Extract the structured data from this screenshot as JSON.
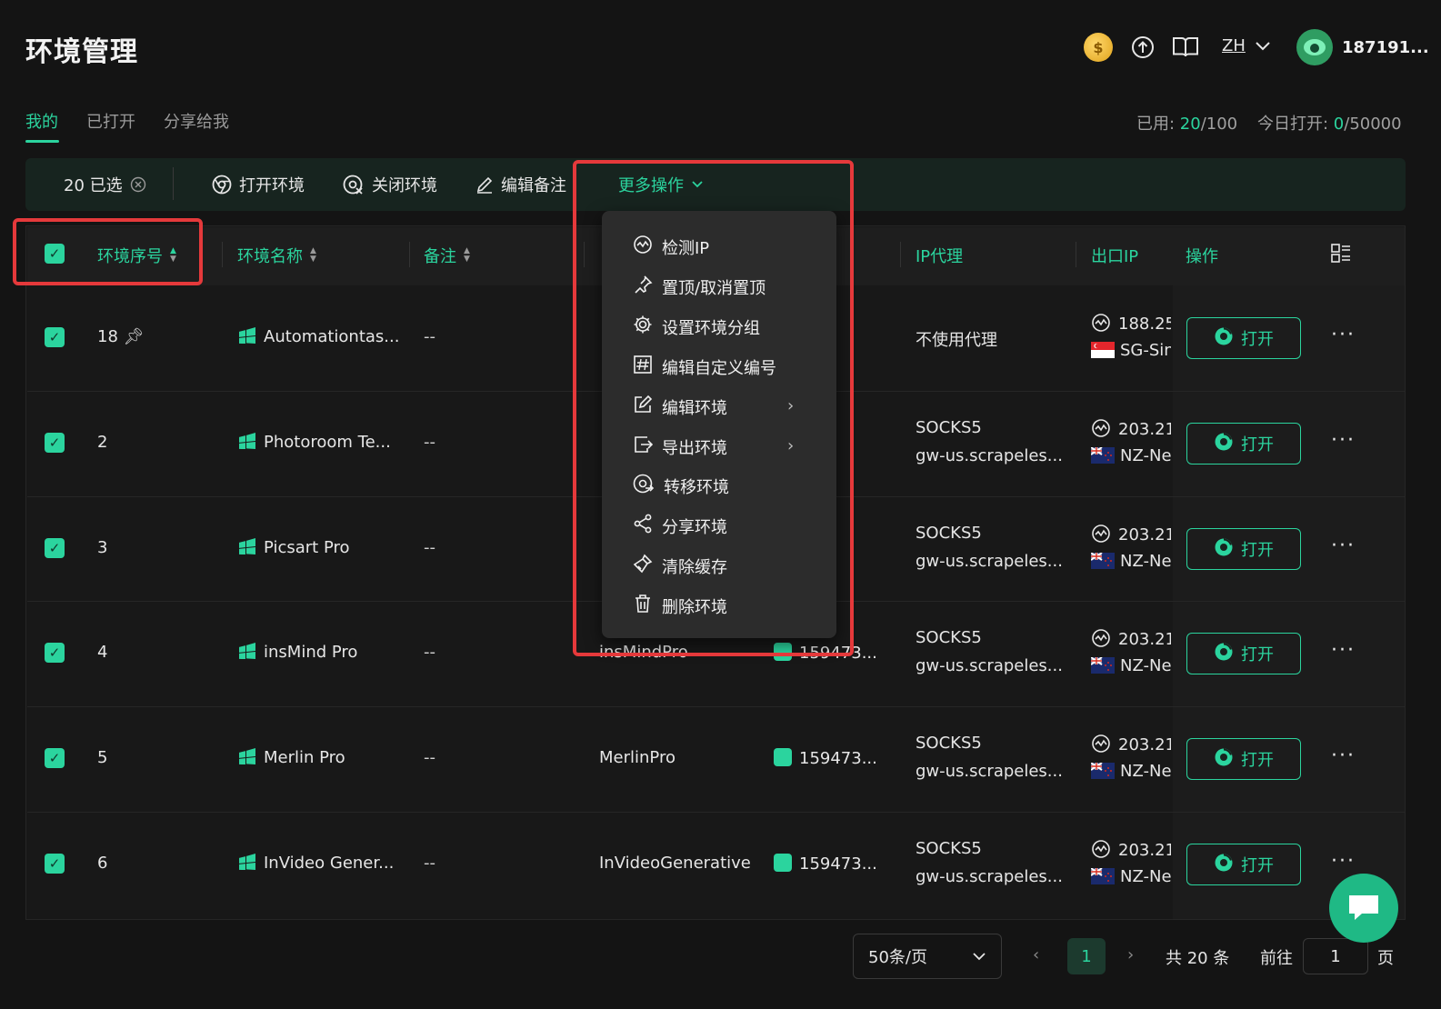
{
  "header": {
    "title": "环境管理",
    "coin_glyph": "$",
    "language": "ZH",
    "username": "187191..."
  },
  "tabs": [
    {
      "label": "我的",
      "active": true
    },
    {
      "label": "已打开",
      "active": false
    },
    {
      "label": "分享给我",
      "active": false
    }
  ],
  "usage": {
    "used_label": "已用: ",
    "used_value": "20",
    "used_total": "/100",
    "today_label": "今日打开: ",
    "today_value": "0",
    "today_total": "/50000"
  },
  "toolbar": {
    "selected_count": "20 已选",
    "open_env": "打开环境",
    "close_env": "关闭环境",
    "edit_note": "编辑备注",
    "more_actions": "更多操作"
  },
  "columns": {
    "seq": "环境序号",
    "name": "环境名称",
    "note": "备注",
    "ip_proxy": "IP代理",
    "exit_ip": "出口IP",
    "actions": "操作"
  },
  "rows": [
    {
      "seq": "18",
      "pinned": true,
      "name": "Automationtas...",
      "note": "--",
      "custom": "",
      "group": "",
      "proxy_line1": "不使用代理",
      "proxy_line2": "",
      "ip_line1": "188.25",
      "ip_line2": "SG-Sin",
      "flag": "sg",
      "open_label": "打开"
    },
    {
      "seq": "2",
      "pinned": false,
      "name": "Photoroom Te...",
      "note": "--",
      "custom": "",
      "group": "",
      "proxy_line1": "SOCKS5",
      "proxy_line2": "gw-us.scrapeles...",
      "ip_line1": "203.21",
      "ip_line2": "NZ-Ne",
      "flag": "nz",
      "open_label": "打开"
    },
    {
      "seq": "3",
      "pinned": false,
      "name": "Picsart Pro",
      "note": "--",
      "custom": "",
      "group": "",
      "proxy_line1": "SOCKS5",
      "proxy_line2": "gw-us.scrapeles...",
      "ip_line1": "203.21",
      "ip_line2": "NZ-Ne",
      "flag": "nz",
      "open_label": "打开"
    },
    {
      "seq": "4",
      "pinned": false,
      "name": "insMind Pro",
      "note": "--",
      "custom": "insMindPro",
      "group": "159473...",
      "proxy_line1": "SOCKS5",
      "proxy_line2": "gw-us.scrapeles...",
      "ip_line1": "203.21",
      "ip_line2": "NZ-Ne",
      "flag": "nz",
      "open_label": "打开"
    },
    {
      "seq": "5",
      "pinned": false,
      "name": "Merlin Pro",
      "note": "--",
      "custom": "MerlinPro",
      "group": "159473...",
      "proxy_line1": "SOCKS5",
      "proxy_line2": "gw-us.scrapeles...",
      "ip_line1": "203.21",
      "ip_line2": "NZ-Ne",
      "flag": "nz",
      "open_label": "打开"
    },
    {
      "seq": "6",
      "pinned": false,
      "name": "InVideo Gener...",
      "note": "--",
      "custom": "InVideoGenerative",
      "group": "159473...",
      "proxy_line1": "SOCKS5",
      "proxy_line2": "gw-us.scrapeles...",
      "ip_line1": "203.21",
      "ip_line2": "NZ-Ne",
      "flag": "nz",
      "open_label": "打开"
    }
  ],
  "dropdown": [
    {
      "label": "检测IP",
      "icon": "check-ip-icon",
      "submenu": false
    },
    {
      "label": "置顶/取消置顶",
      "icon": "pin-icon",
      "submenu": false
    },
    {
      "label": "设置环境分组",
      "icon": "gear-icon",
      "submenu": false
    },
    {
      "label": "编辑自定义编号",
      "icon": "hash-icon",
      "submenu": false
    },
    {
      "label": "编辑环境",
      "icon": "edit-icon",
      "submenu": true
    },
    {
      "label": "导出环境",
      "icon": "export-icon",
      "submenu": true
    },
    {
      "label": "转移环境",
      "icon": "transfer-icon",
      "submenu": false
    },
    {
      "label": "分享环境",
      "icon": "share-icon",
      "submenu": false
    },
    {
      "label": "清除缓存",
      "icon": "broom-icon",
      "submenu": false
    },
    {
      "label": "删除环境",
      "icon": "trash-icon",
      "submenu": false
    }
  ],
  "pagination": {
    "page_size": "50条/页",
    "current_page": "1",
    "total": "共 20 条",
    "goto_label": "前往",
    "goto_value": "1",
    "page_suffix": "页"
  },
  "colors": {
    "accent": "#2bd49e",
    "highlight": "#e5393b",
    "background": "#141414"
  }
}
